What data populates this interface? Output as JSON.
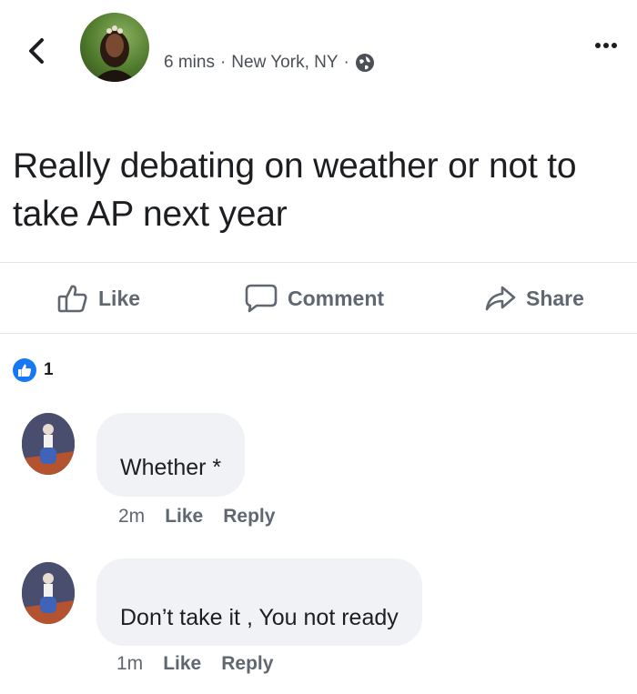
{
  "header": {
    "time": "6 mins",
    "separator": "·",
    "location": "New York, NY",
    "privacy_icon": "globe-icon",
    "more_icon": "ellipsis-icon"
  },
  "post": {
    "text": "Really debating on weather or not to take AP next year"
  },
  "actions": {
    "like": "Like",
    "comment": "Comment",
    "share": "Share"
  },
  "reactions": {
    "count": "1",
    "icon": "like-badge-icon",
    "color": "#1877f2"
  },
  "comments": [
    {
      "text": "Whether *",
      "time": "2m",
      "like": "Like",
      "reply": "Reply"
    },
    {
      "text": "Don’t take it , You not ready",
      "time": "1m",
      "like": "Like",
      "reply": "Reply"
    }
  ]
}
